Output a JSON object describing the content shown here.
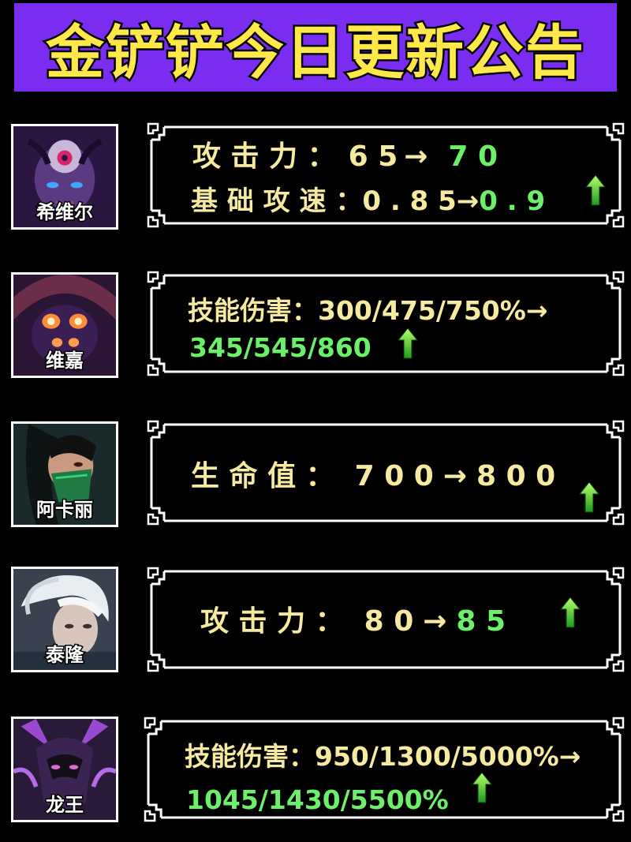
{
  "title": "金铲铲今日更新公告",
  "colors": {
    "banner": "#7a2cf0",
    "title": "#ffe84a",
    "old": "#f6e9a0",
    "new": "#6cf06a"
  },
  "arrow": "→",
  "champions": [
    {
      "name": "希维尔",
      "lines": [
        {
          "label": "攻 击 力 ：",
          "old": "6 5",
          "new": "7 0"
        },
        {
          "label": "基 础 攻 速 ：",
          "old": "0 . 8 5",
          "new": "0 . 9"
        }
      ],
      "icon": "up-arrow-icon"
    },
    {
      "name": "维嘉",
      "lines": [
        {
          "label": "技能伤害：",
          "old": "300/475/750%",
          "new": "345/545/860"
        }
      ],
      "icon": "up-arrow-icon"
    },
    {
      "name": "阿卡丽",
      "lines": [
        {
          "label": "生 命 值 ：",
          "old": "7 0 0",
          "new": "8 0 0"
        }
      ],
      "icon": "up-arrow-icon"
    },
    {
      "name": "泰隆",
      "lines": [
        {
          "label": "攻 击 力 ：",
          "old": "8 0",
          "new": "8 5"
        }
      ],
      "icon": "up-arrow-icon"
    },
    {
      "name": "龙王",
      "lines": [
        {
          "label": "技能伤害：",
          "old": "950/1300/5000%",
          "new": "1045/1430/5500%"
        }
      ],
      "icon": "up-arrow-icon"
    }
  ]
}
